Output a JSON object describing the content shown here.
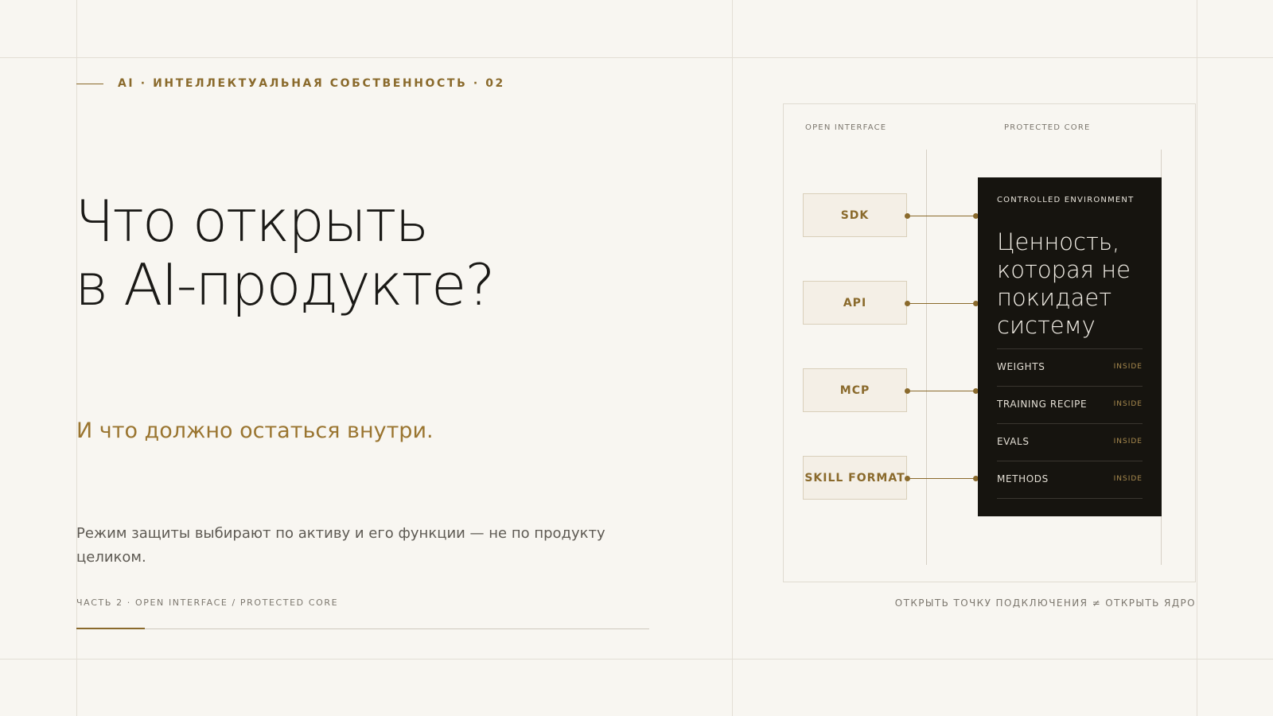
{
  "eyebrow": "AI · ИНТЕЛЛЕКТУАЛЬНАЯ СОБСТВЕННОСТЬ · 02",
  "title": {
    "line1": "Что открыть",
    "line2": "в AI-продукте?"
  },
  "subtitle": "И что должно остаться внутри.",
  "body": "Режим защиты выбирают по активу и его функции — не по продукту целиком.",
  "footer": {
    "label": "ЧАСТЬ 2 · OPEN INTERFACE / PROTECTED CORE",
    "progress": 0.12
  },
  "diagram": {
    "open_label": "OPEN INTERFACE",
    "core_label": "PROTECTED CORE",
    "interfaces": [
      "SDK",
      "API",
      "MCP",
      "SKILL FORMAT"
    ],
    "core": {
      "label": "CONTROLLED ENVIRONMENT",
      "title": "Ценность, которая не покидает систему",
      "items": [
        {
          "name": "WEIGHTS",
          "status": "INSIDE"
        },
        {
          "name": "TRAINING RECIPE",
          "status": "INSIDE"
        },
        {
          "name": "EVALS",
          "status": "INSIDE"
        },
        {
          "name": "METHODS",
          "status": "INSIDE"
        }
      ]
    },
    "tagline": "ОТКРЫТЬ ТОЧКУ ПОДКЛЮЧЕНИЯ ≠ ОТКРЫТЬ ЯДРО"
  },
  "colors": {
    "accent": "#8a6a2c",
    "background": "#f8f6f1",
    "core_background": "#16140f"
  }
}
